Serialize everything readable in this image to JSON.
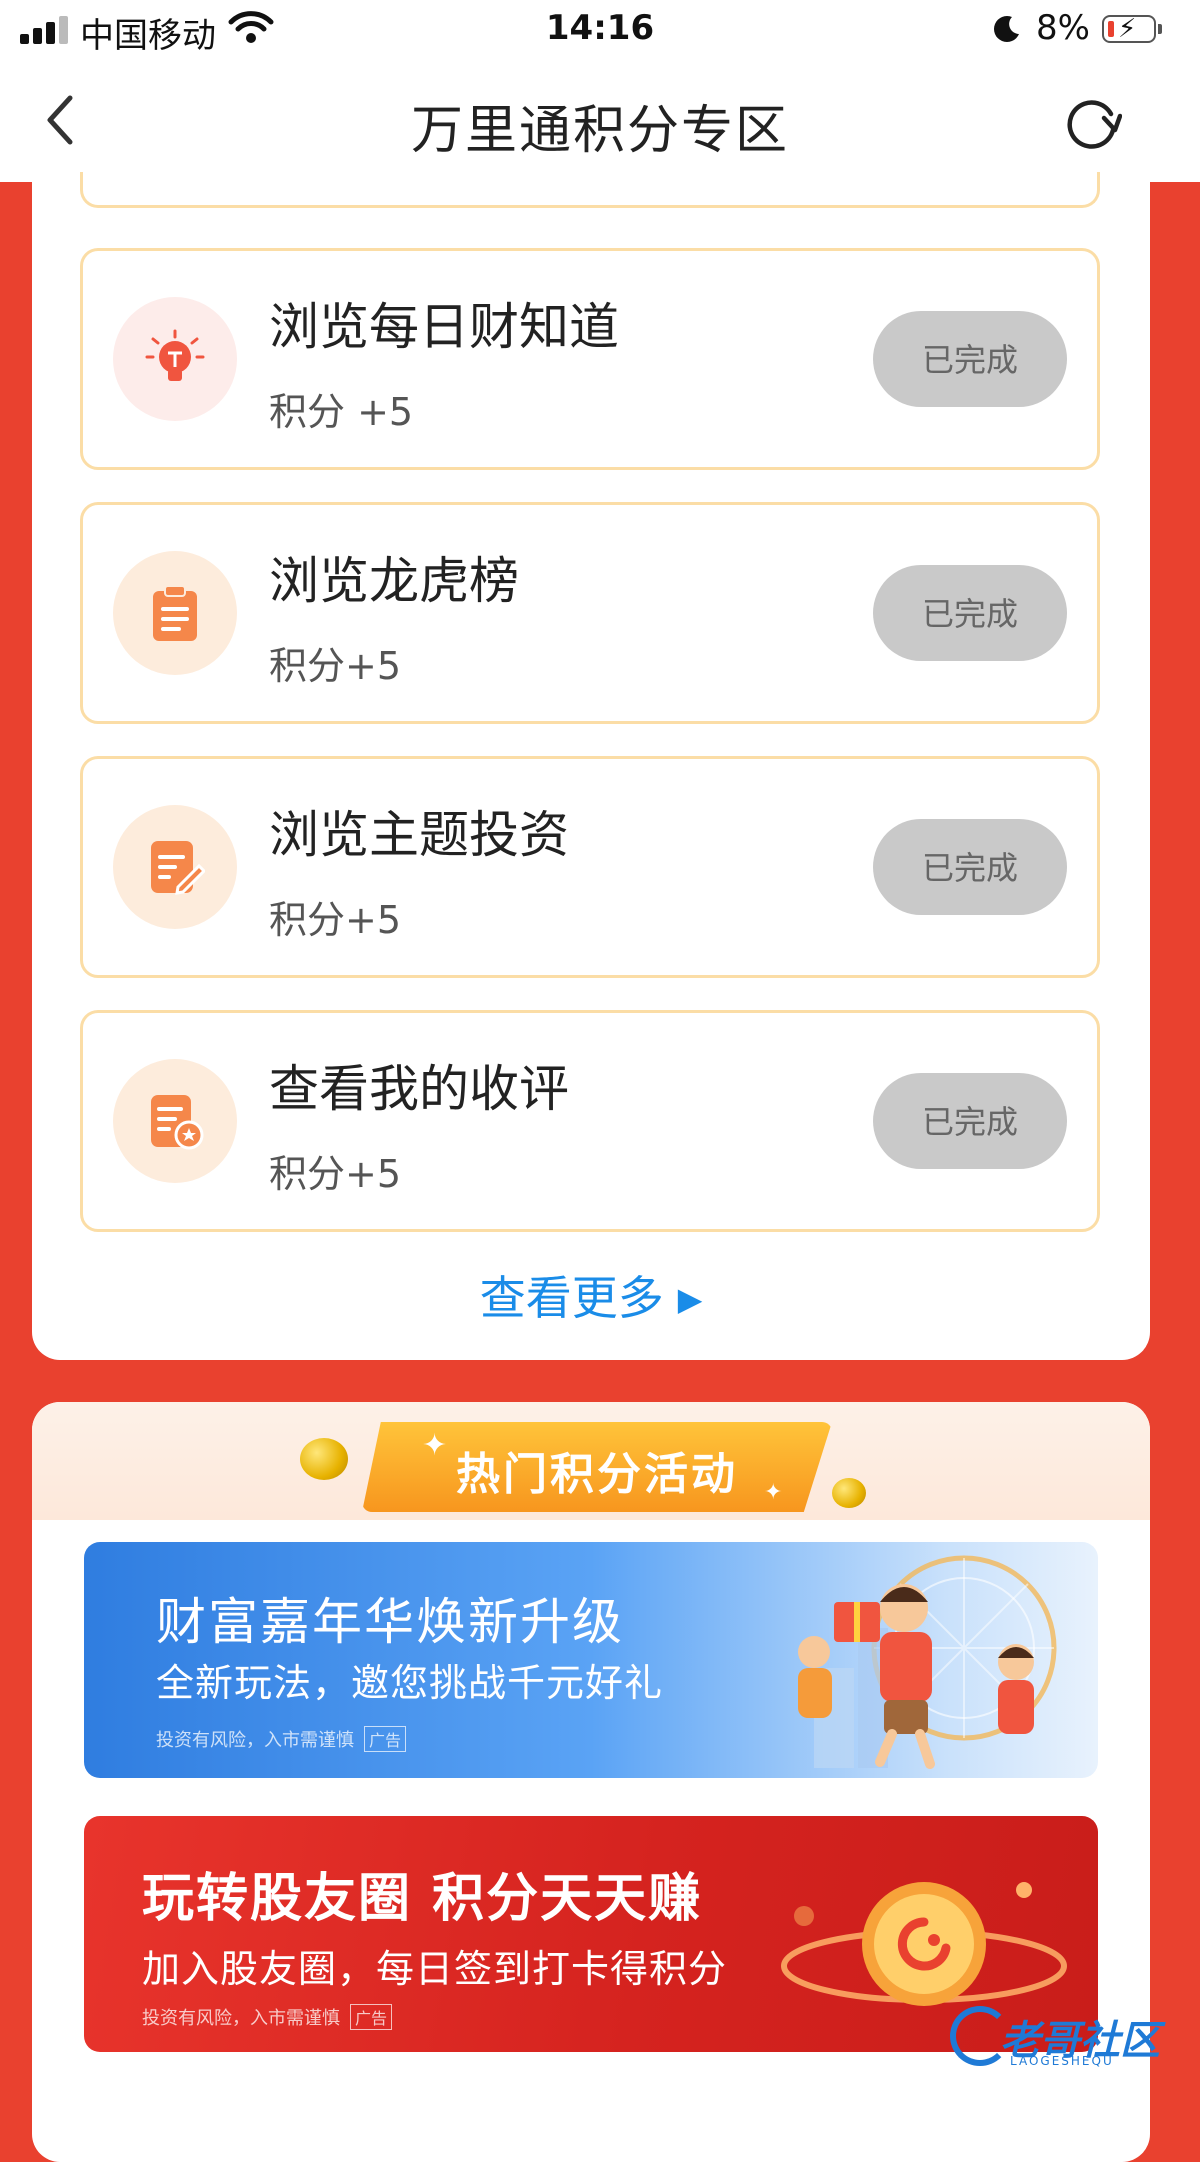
{
  "status_bar": {
    "carrier": "中国移动",
    "time": "14:16",
    "battery": "8%"
  },
  "nav": {
    "title": "万里通积分专区"
  },
  "tasks": [
    {
      "name": "浏览每日财知道",
      "points": "积分 +5",
      "status": "已完成",
      "icon": "lightbulb-icon",
      "icon_bg": "#fdecea",
      "icon_color": "#f0553f"
    },
    {
      "name": "浏览龙虎榜",
      "points": "积分+5",
      "status": "已完成",
      "icon": "clipboard-icon",
      "icon_bg": "#fdecdc",
      "icon_color": "#f5874a"
    },
    {
      "name": "浏览主题投资",
      "points": "积分+5",
      "status": "已完成",
      "icon": "edit-document-icon",
      "icon_bg": "#fdecdc",
      "icon_color": "#f5874a"
    },
    {
      "name": "查看我的收评",
      "points": "积分+5",
      "status": "已完成",
      "icon": "review-document-icon",
      "icon_bg": "#fdecdc",
      "icon_color": "#f5874a"
    }
  ],
  "more_link": "查看更多",
  "activities": {
    "header": "热门积分活动",
    "banners": [
      {
        "title": "财富嘉年华焕新升级",
        "subtitle": "全新玩法，邀您挑战千元好礼",
        "risk": "投资有风险，入市需谨慎",
        "ad_tag": "广告"
      },
      {
        "title": "玩转股友圈 积分天天赚",
        "subtitle": "加入股友圈，每日签到打卡得积分",
        "risk": "投资有风险，入市需谨慎",
        "ad_tag": "广告"
      }
    ]
  },
  "watermark": {
    "text": "老哥社区",
    "sub": "LAOGESHEQU"
  }
}
